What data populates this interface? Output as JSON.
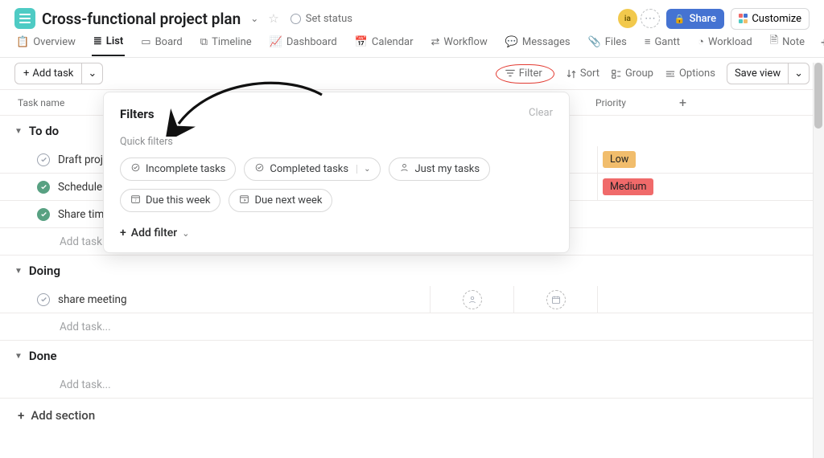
{
  "header": {
    "title": "Cross-functional project plan",
    "set_status": "Set status",
    "avatar_initials": "ia",
    "share": "Share",
    "customize": "Customize"
  },
  "tabs": {
    "items": [
      "Overview",
      "List",
      "Board",
      "Timeline",
      "Dashboard",
      "Calendar",
      "Workflow",
      "Messages",
      "Files",
      "Gantt",
      "Workload",
      "Note"
    ],
    "active_index": 1
  },
  "toolbar": {
    "add_task": "Add task",
    "filter": "Filter",
    "sort": "Sort",
    "group": "Group",
    "options": "Options",
    "save_view": "Save view"
  },
  "columns": {
    "c1": "Task name",
    "c4": "Priority"
  },
  "sections": [
    {
      "name": "To do",
      "rows": [
        {
          "name": "Draft proj",
          "done": false,
          "priority": "Low"
        },
        {
          "name": "Schedule",
          "done": true,
          "priority": "Medium"
        },
        {
          "name": "Share tim",
          "done": true
        }
      ],
      "add_row": "Add task..."
    },
    {
      "name": "Doing",
      "rows": [
        {
          "name": "share meeting",
          "done": false,
          "show_placeholders": true
        }
      ],
      "add_row": "Add task..."
    },
    {
      "name": "Done",
      "rows": [],
      "add_row": "Add task..."
    }
  ],
  "add_section": "Add section",
  "popover": {
    "title": "Filters",
    "clear": "Clear",
    "subtitle": "Quick filters",
    "chips": [
      "Incomplete tasks",
      "Completed tasks",
      "Just my tasks",
      "Due this week",
      "Due next week"
    ],
    "add_filter": "Add filter"
  },
  "priority_labels": {
    "Low": "Low",
    "Medium": "Medium"
  }
}
